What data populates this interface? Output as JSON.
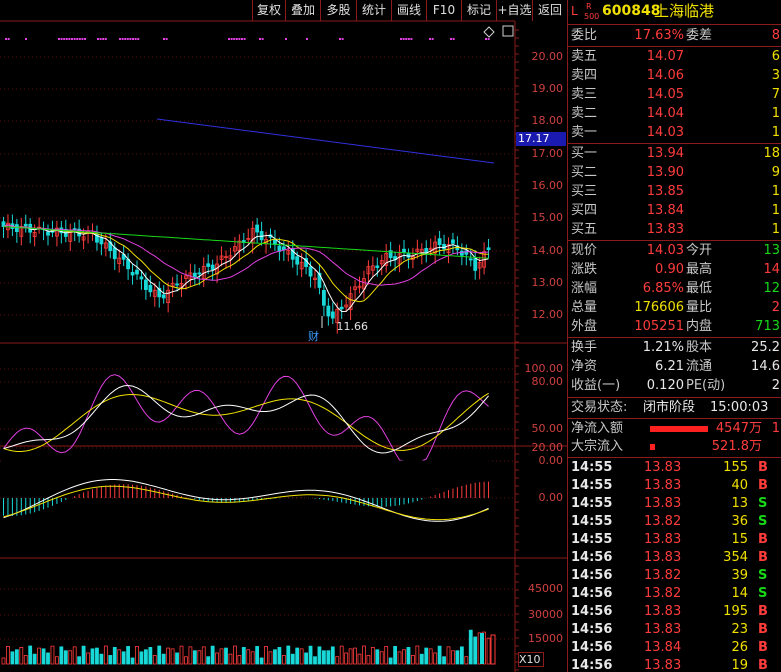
{
  "toolbar": {
    "buttons": [
      "复权",
      "叠加",
      "多股",
      "统计",
      "画线",
      "F10",
      "标记",
      "+自选",
      "返回"
    ]
  },
  "axes": {
    "price_ticks": [
      "20.00",
      "19.00",
      "18.00",
      "17.00",
      "16.00",
      "15.00",
      "14.00",
      "13.00",
      "12.00"
    ],
    "price_marker": "17.17",
    "low_annotation": "11.66",
    "cai_mark": "财",
    "kdj_ticks": [
      "100.00",
      "80.00",
      "50.00",
      "20.00",
      "0.00"
    ],
    "macd_ticks": [
      "0.00"
    ],
    "vol_ticks": [
      "45000",
      "30000",
      "15000"
    ],
    "vol_unit": "X10"
  },
  "stock": {
    "badge_l": "L",
    "badge_r": "R",
    "badge_num": "500",
    "code": "600848",
    "name": "上海临港"
  },
  "weibi": {
    "label1": "委比",
    "val1": "17.63%",
    "label2": "委差",
    "val2": "8"
  },
  "sell": [
    {
      "label": "卖五",
      "price": "14.07",
      "vol": "6"
    },
    {
      "label": "卖四",
      "price": "14.06",
      "vol": "3"
    },
    {
      "label": "卖三",
      "price": "14.05",
      "vol": "7"
    },
    {
      "label": "卖二",
      "price": "14.04",
      "vol": "1"
    },
    {
      "label": "卖一",
      "price": "14.03",
      "vol": "1"
    }
  ],
  "buy": [
    {
      "label": "买一",
      "price": "13.94",
      "vol": "18"
    },
    {
      "label": "买二",
      "price": "13.90",
      "vol": "9"
    },
    {
      "label": "买三",
      "price": "13.85",
      "vol": "1"
    },
    {
      "label": "买四",
      "price": "13.84",
      "vol": "1"
    },
    {
      "label": "买五",
      "price": "13.83",
      "vol": "1"
    }
  ],
  "quote": [
    {
      "l1": "现价",
      "v1": "14.03",
      "l2": "今开",
      "v2": "13"
    },
    {
      "l1": "涨跌",
      "v1": "0.90",
      "l2": "最高",
      "v2": "14"
    },
    {
      "l1": "涨幅",
      "v1": "6.85%",
      "l2": "最低",
      "v2": "12"
    },
    {
      "l1": "总量",
      "v1": "176606",
      "l2": "量比",
      "v2": "2"
    },
    {
      "l1": "外盘",
      "v1": "105251",
      "l2": "内盘",
      "v2": "713"
    }
  ],
  "fund": [
    {
      "l1": "换手",
      "v1": "1.21%",
      "l2": "股本",
      "v2": "25.2"
    },
    {
      "l1": "净资",
      "v1": "6.21",
      "l2": "流通",
      "v2": "14.6"
    },
    {
      "l1": "收益(一)",
      "v1": "0.120",
      "l2": "PE(动)",
      "v2": "2"
    }
  ],
  "status": {
    "label": "交易状态:",
    "value": "闭市阶段",
    "time": "15:00:03"
  },
  "flow": [
    {
      "label": "净流入额",
      "value": "4547万",
      "extra": "1"
    },
    {
      "label": "大宗流入",
      "value": "521.8万",
      "extra": ""
    }
  ],
  "ticks": [
    {
      "t": "14:55",
      "p": "13.83",
      "v": "155",
      "s": "B"
    },
    {
      "t": "14:55",
      "p": "13.83",
      "v": "40",
      "s": "B"
    },
    {
      "t": "14:55",
      "p": "13.83",
      "v": "13",
      "s": "S"
    },
    {
      "t": "14:55",
      "p": "13.82",
      "v": "36",
      "s": "S"
    },
    {
      "t": "14:55",
      "p": "13.83",
      "v": "15",
      "s": "B"
    },
    {
      "t": "14:56",
      "p": "13.83",
      "v": "354",
      "s": "B"
    },
    {
      "t": "14:56",
      "p": "13.82",
      "v": "39",
      "s": "S"
    },
    {
      "t": "14:56",
      "p": "13.82",
      "v": "14",
      "s": "S"
    },
    {
      "t": "14:56",
      "p": "13.83",
      "v": "195",
      "s": "B"
    },
    {
      "t": "14:56",
      "p": "13.83",
      "v": "23",
      "s": "B"
    },
    {
      "t": "14:56",
      "p": "13.84",
      "v": "26",
      "s": "B"
    },
    {
      "t": "14:56",
      "p": "13.83",
      "v": "19",
      "s": "B"
    }
  ],
  "colors": {
    "up": "#ff3c3c",
    "down": "#18d8d8",
    "grid": "#8b1a1a",
    "ma5": "#ffffff",
    "ma10": "#f0e000",
    "ma20": "#e040e0",
    "ma60": "#18d818",
    "trend": "#3030e0"
  }
}
